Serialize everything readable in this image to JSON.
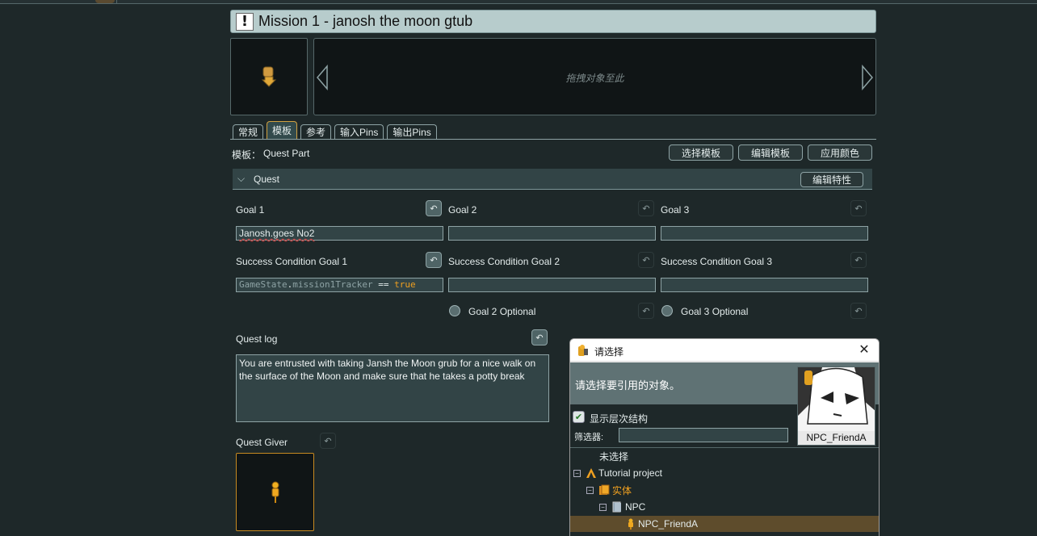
{
  "mission": {
    "title": "Mission 1 - janosh the moon gtub",
    "title_icon": "exclamation-icon"
  },
  "dropzone": {
    "hint": "拖拽对象至此"
  },
  "tabs": [
    {
      "label": "常规"
    },
    {
      "label": "模板"
    },
    {
      "label": "参考"
    },
    {
      "label": "输入Pins"
    },
    {
      "label": "输出Pins"
    }
  ],
  "template": {
    "label": "模板：",
    "value": "Quest Part",
    "select_button": "选择模板",
    "edit_button": "编辑模板",
    "apply_color_button": "应用颜色"
  },
  "section": {
    "title": "Quest",
    "edit_props_button": "编辑特性"
  },
  "goals": [
    {
      "label": "Goal 1",
      "value": "Janosh.goes No2",
      "success_label": "Success Condition Goal 1",
      "success_code": {
        "obj": "GameState",
        "dot": ".",
        "prop": "mission1Tracker",
        "op": " == ",
        "kw": "true"
      }
    },
    {
      "label": "Goal 2",
      "value": "",
      "success_label": "Success Condition Goal 2",
      "optional_label": "Goal 2 Optional"
    },
    {
      "label": "Goal 3",
      "value": "",
      "success_label": "Success Condition Goal 3",
      "optional_label": "Goal 3 Optional"
    }
  ],
  "quest_log": {
    "label": "Quest log",
    "text": "You are entrusted with taking Jansh the Moon grub for a nice walk on the surface of the Moon and make sure that he takes a potty break"
  },
  "quest_giver": {
    "label": "Quest Giver"
  },
  "dialog": {
    "title": "请选择",
    "prompt": "请选择要引用的对象。",
    "show_hierarchy": "显示层次结构",
    "show_hierarchy_checked": true,
    "filter_label": "筛选器:",
    "filter_value": "",
    "thumb_caption": "NPC_FriendA",
    "tree": {
      "none": "未选择",
      "project": "Tutorial project",
      "entities": "实体",
      "npc": "NPC",
      "selected": "NPC_FriendA"
    }
  },
  "colors": {
    "accent": "#d0a040",
    "background": "#1e2829",
    "field": "#324446",
    "selection": "#5e4c2c",
    "keyword": "#f0a020"
  }
}
